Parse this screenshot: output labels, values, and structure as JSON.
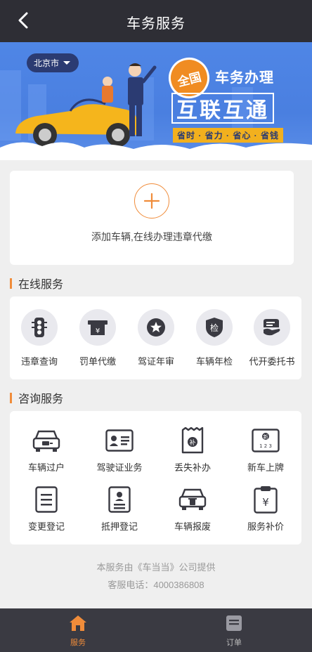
{
  "header": {
    "title": "车务服务"
  },
  "banner": {
    "city": "北京市",
    "badge": "全国",
    "line1": "车务办理",
    "line2": "互联互通",
    "slogan": "省时 · 省力 · 省心 · 省钱"
  },
  "add_vehicle": {
    "text": "添加车辆,在线办理违章代缴"
  },
  "online": {
    "title": "在线服务",
    "items": [
      {
        "label": "违章查询",
        "icon": "traffic-light-icon"
      },
      {
        "label": "罚单代缴",
        "icon": "fine-ticket-icon"
      },
      {
        "label": "驾证年审",
        "icon": "star-badge-icon"
      },
      {
        "label": "车辆年检",
        "icon": "inspection-shield-icon"
      },
      {
        "label": "代开委托书",
        "icon": "document-hand-icon"
      }
    ]
  },
  "consult": {
    "title": "咨询服务",
    "items": [
      {
        "label": "车辆过户",
        "icon": "car-transfer-icon"
      },
      {
        "label": "驾驶证业务",
        "icon": "license-card-icon"
      },
      {
        "label": "丢失补办",
        "icon": "replace-tag-icon"
      },
      {
        "label": "新车上牌",
        "icon": "new-plate-icon"
      },
      {
        "label": "变更登记",
        "icon": "change-doc-icon"
      },
      {
        "label": "抵押登记",
        "icon": "mortgage-doc-icon"
      },
      {
        "label": "车辆报废",
        "icon": "car-scrap-icon"
      },
      {
        "label": "服务补价",
        "icon": "price-clipboard-icon"
      }
    ]
  },
  "footer": {
    "provider": "本服务由《车当当》公司提供",
    "hotline": "客服电话：4000386808"
  },
  "tabs": [
    {
      "label": "服务",
      "icon": "home-icon",
      "active": true
    },
    {
      "label": "订单",
      "icon": "order-icon",
      "active": false
    }
  ],
  "colors": {
    "accent": "#f08c3a",
    "header": "#2e2e35",
    "tabbar": "#3a3a42"
  }
}
